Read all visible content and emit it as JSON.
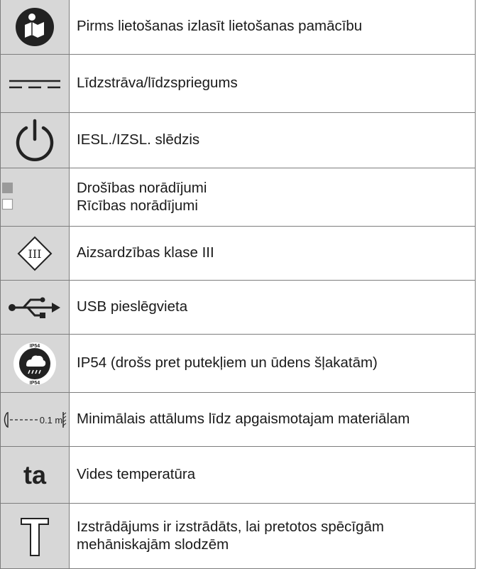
{
  "rows": [
    {
      "icon": "read-manual-icon",
      "text": "Pirms lietošanas izlasīt lietošanas pamācību"
    },
    {
      "icon": "direct-current-icon",
      "text": "Līdzstrāva/līdzspriegums"
    },
    {
      "icon": "power-icon",
      "text": "IESL./IZSL. slēdzis"
    },
    {
      "icon": "notes-squares-icon",
      "lines": [
        "Drošības norādījumi",
        "Rīcības norādījumi"
      ]
    },
    {
      "icon": "protection-class-iii-icon",
      "icon_text": "III",
      "text": "Aizsardzības klase III"
    },
    {
      "icon": "usb-icon",
      "text": "USB pieslēgvieta"
    },
    {
      "icon": "ip54-icon",
      "icon_text": "IP54",
      "text": "IP54 (drošs pret putekļiem un ūdens šļakatām)"
    },
    {
      "icon": "minimum-distance-icon",
      "icon_text": "0.1 m",
      "text": "Minimālais attālums līdz apgaismotajam materiālam"
    },
    {
      "icon": "ambient-temperature-icon",
      "icon_text": "ta",
      "text": "Vides temperatūra"
    },
    {
      "icon": "hammer-icon",
      "lines": [
        "Izstrādājums ir izstrādāts, lai pretotos spēcīgām",
        "mehāniskajām slodzēm"
      ]
    }
  ],
  "colors": {
    "icon_column": "#d7d7d7",
    "border": "#7d7d7d",
    "square_gray": "#9a9a9a"
  }
}
